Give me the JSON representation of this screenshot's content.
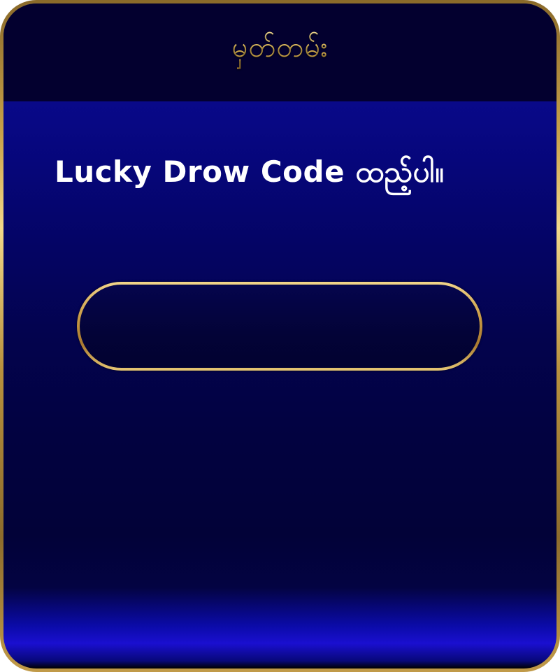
{
  "dialog": {
    "title": "မှတ်တမ်း",
    "prompt": "Lucky Drow Code ထည့်ပါ။",
    "code_input": {
      "value": "",
      "placeholder": ""
    }
  },
  "colors": {
    "gold_border": "#c9a24a",
    "header_bg": "#03002f",
    "panel_blue": "#0a0a93",
    "panel_dark": "#020238",
    "title_gold": "#e8c35a",
    "prompt_text": "#ffffff"
  }
}
